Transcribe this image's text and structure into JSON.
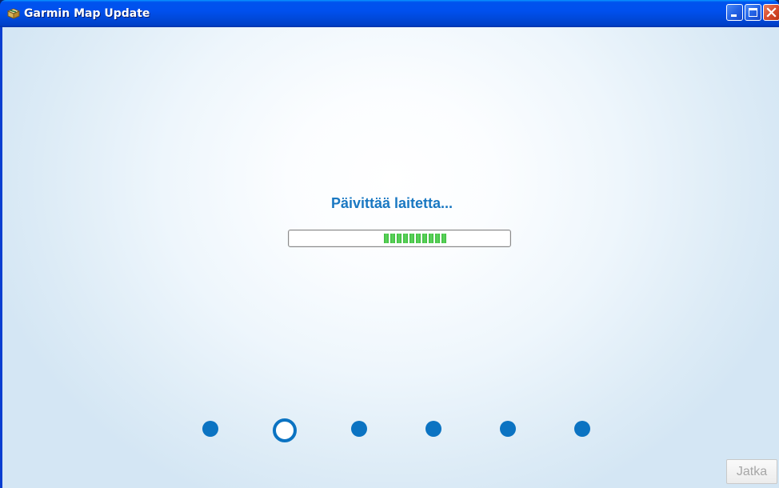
{
  "window": {
    "title": "Garmin Map Update",
    "icon": "garmin-app-icon",
    "controls": [
      "minimize-icon",
      "maximize-icon",
      "close-icon"
    ]
  },
  "main": {
    "status_text": "Päivittää laitetta...",
    "progress": {
      "fill_fraction_start": 0.43,
      "fill_fraction_end": 0.72,
      "color": "#3dbb3d"
    },
    "steps": {
      "count": 6,
      "active_index": 1,
      "color": "#0b73c2"
    },
    "next_button": {
      "label": "Jatka",
      "enabled": false
    }
  }
}
